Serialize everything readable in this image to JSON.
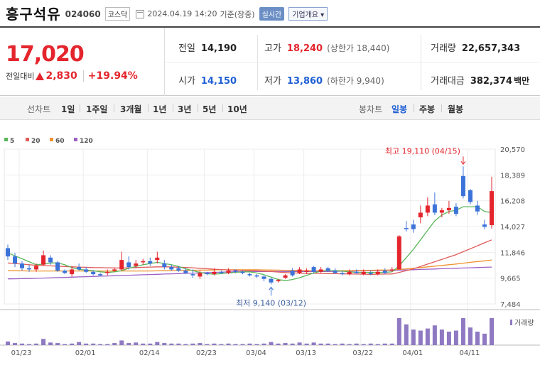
{
  "header": {
    "name": "흥구석유",
    "code": "024060",
    "market": "코스닥",
    "datetime": "2024.04.19 14:20",
    "basis": "기준(장중)",
    "realtime_label": "실시간",
    "company_button": "기업개요 ▾"
  },
  "price": {
    "current": "17,020",
    "change_label": "전일대비",
    "change": "2,830",
    "change_pct": "+19.94%",
    "prev_close_label": "전일",
    "prev_close": "14,190",
    "high_label": "고가",
    "high": "18,240",
    "upper_limit": "(상한가 18,440)",
    "volume_label": "거래량",
    "volume": "22,657,343",
    "open_label": "시가",
    "open": "14,150",
    "low_label": "저가",
    "low": "13,860",
    "lower_limit": "(하한가 9,940)",
    "amount_label": "거래대금",
    "amount": "382,374",
    "amount_unit": "백만"
  },
  "periods": {
    "line_label": "선차트",
    "items": [
      "1일",
      "1주일",
      "3개월",
      "1년",
      "3년",
      "5년",
      "10년"
    ],
    "candle_label": "봉차트",
    "candle_items": [
      "일봉",
      "주봉",
      "월봉"
    ],
    "candle_active": "일봉"
  },
  "colors": {
    "up": "#e4252d",
    "down": "#3b73d9",
    "ma5": "#5ab65a",
    "ma20": "#e05a5a",
    "ma60": "#f0922e",
    "ma120": "#9b62c7",
    "volume": "#8e79c2"
  },
  "chart_data": {
    "type": "candlestick",
    "legend": [
      "5",
      "20",
      "60",
      "120"
    ],
    "x_tick_labels": [
      "01/23",
      "02/01",
      "02/14",
      "02/23",
      "03/04",
      "03/13",
      "03/22",
      "04/01",
      "04/11"
    ],
    "y_tick_labels": [
      "20,570",
      "18,389",
      "16,208",
      "14,027",
      "11,846",
      "9,665",
      "7,484"
    ],
    "ylim": [
      7484,
      20570
    ],
    "high_annotation": "최고 19,110 (04/15)",
    "low_annotation": "최저 9,140 (03/12)",
    "volume_label": "거래량",
    "candles": [
      {
        "o": 12200,
        "c": 11500,
        "h": 12500,
        "l": 11200
      },
      {
        "o": 11500,
        "c": 10900,
        "h": 11800,
        "l": 10600
      },
      {
        "o": 10900,
        "c": 10500,
        "h": 11100,
        "l": 10300
      },
      {
        "o": 10500,
        "c": 10400,
        "h": 10800,
        "l": 10200
      },
      {
        "o": 10400,
        "c": 10700,
        "h": 10900,
        "l": 10200
      },
      {
        "o": 10800,
        "c": 11600,
        "h": 12000,
        "l": 10700
      },
      {
        "o": 11400,
        "c": 11000,
        "h": 11600,
        "l": 10800
      },
      {
        "o": 11000,
        "c": 10300,
        "h": 11100,
        "l": 10200
      },
      {
        "o": 10300,
        "c": 10100,
        "h": 10400,
        "l": 10000
      },
      {
        "o": 10000,
        "c": 10400,
        "h": 10700,
        "l": 9800
      },
      {
        "o": 10600,
        "c": 10400,
        "h": 10900,
        "l": 10300
      },
      {
        "o": 10400,
        "c": 10200,
        "h": 10600,
        "l": 10100
      },
      {
        "o": 10200,
        "c": 10000,
        "h": 10300,
        "l": 9900
      },
      {
        "o": 10000,
        "c": 9900,
        "h": 10100,
        "l": 9800
      },
      {
        "o": 10100,
        "c": 10200,
        "h": 10400,
        "l": 9900
      },
      {
        "o": 10300,
        "c": 10400,
        "h": 10500,
        "l": 10200
      },
      {
        "o": 10400,
        "c": 11200,
        "h": 11900,
        "l": 10300
      },
      {
        "o": 11000,
        "c": 10600,
        "h": 11500,
        "l": 10400
      },
      {
        "o": 10700,
        "c": 10900,
        "h": 11200,
        "l": 10500
      },
      {
        "o": 11000,
        "c": 11100,
        "h": 11300,
        "l": 10800
      },
      {
        "o": 11100,
        "c": 10900,
        "h": 11400,
        "l": 10700
      },
      {
        "o": 11200,
        "c": 11400,
        "h": 11900,
        "l": 10900
      },
      {
        "o": 10900,
        "c": 10600,
        "h": 11200,
        "l": 10400
      },
      {
        "o": 10600,
        "c": 10400,
        "h": 10800,
        "l": 10300
      },
      {
        "o": 10500,
        "c": 10300,
        "h": 10700,
        "l": 10200
      },
      {
        "o": 10300,
        "c": 10100,
        "h": 10500,
        "l": 10000
      },
      {
        "o": 10000,
        "c": 9900,
        "h": 10400,
        "l": 9700
      },
      {
        "o": 9800,
        "c": 10100,
        "h": 10300,
        "l": 9600
      },
      {
        "o": 10100,
        "c": 10000,
        "h": 10200,
        "l": 9900
      },
      {
        "o": 10000,
        "c": 10200,
        "h": 10500,
        "l": 9900
      },
      {
        "o": 10200,
        "c": 10100,
        "h": 10300,
        "l": 10000
      },
      {
        "o": 10100,
        "c": 10300,
        "h": 10500,
        "l": 10000
      },
      {
        "o": 10300,
        "c": 10200,
        "h": 10400,
        "l": 10100
      },
      {
        "o": 10200,
        "c": 10100,
        "h": 10300,
        "l": 10000
      },
      {
        "o": 10000,
        "c": 9900,
        "h": 10100,
        "l": 9800
      },
      {
        "o": 9900,
        "c": 9800,
        "h": 10000,
        "l": 9700
      },
      {
        "o": 9800,
        "c": 9600,
        "h": 9900,
        "l": 9400
      },
      {
        "o": 9600,
        "c": 9300,
        "h": 9700,
        "l": 9140
      },
      {
        "o": 9400,
        "c": 9500,
        "h": 9600,
        "l": 9300
      },
      {
        "o": 9700,
        "c": 9900,
        "h": 10000,
        "l": 9600
      },
      {
        "o": 10300,
        "c": 9900,
        "h": 10500,
        "l": 9800
      },
      {
        "o": 10100,
        "c": 10400,
        "h": 10600,
        "l": 10000
      },
      {
        "o": 10200,
        "c": 10300,
        "h": 10500,
        "l": 10000
      },
      {
        "o": 10600,
        "c": 10200,
        "h": 10700,
        "l": 10100
      },
      {
        "o": 10200,
        "c": 10400,
        "h": 10600,
        "l": 10100
      },
      {
        "o": 10500,
        "c": 10300,
        "h": 10600,
        "l": 10200
      },
      {
        "o": 10300,
        "c": 10100,
        "h": 10500,
        "l": 10000
      },
      {
        "o": 10100,
        "c": 10000,
        "h": 10300,
        "l": 9900
      },
      {
        "o": 10000,
        "c": 10200,
        "h": 10400,
        "l": 9900
      },
      {
        "o": 10200,
        "c": 10100,
        "h": 10400,
        "l": 10000
      },
      {
        "o": 10000,
        "c": 10200,
        "h": 10400,
        "l": 9900
      },
      {
        "o": 10100,
        "c": 10000,
        "h": 10300,
        "l": 9900
      },
      {
        "o": 10000,
        "c": 10200,
        "h": 10400,
        "l": 9900
      },
      {
        "o": 10300,
        "c": 10100,
        "h": 10500,
        "l": 10000
      },
      {
        "o": 10300,
        "c": 10400,
        "h": 10600,
        "l": 10200
      },
      {
        "o": 10400,
        "c": 13200,
        "h": 13300,
        "l": 10400
      },
      {
        "o": 13900,
        "c": 13800,
        "h": 14500,
        "l": 13600
      },
      {
        "o": 14200,
        "c": 13800,
        "h": 14600,
        "l": 13500
      },
      {
        "o": 14800,
        "c": 15200,
        "h": 15800,
        "l": 14300
      },
      {
        "o": 15200,
        "c": 15800,
        "h": 16500,
        "l": 14900
      },
      {
        "o": 15900,
        "c": 15200,
        "h": 16900,
        "l": 15000
      },
      {
        "o": 15200,
        "c": 15400,
        "h": 15600,
        "l": 14800
      },
      {
        "o": 15400,
        "c": 15600,
        "h": 16200,
        "l": 15100
      },
      {
        "o": 15700,
        "c": 15100,
        "h": 16000,
        "l": 14900
      },
      {
        "o": 18300,
        "c": 16600,
        "h": 19110,
        "l": 16400
      },
      {
        "o": 17100,
        "c": 16100,
        "h": 17200,
        "l": 15900
      },
      {
        "o": 15800,
        "c": 15300,
        "h": 16200,
        "l": 15000
      },
      {
        "o": 14200,
        "c": 14000,
        "h": 14600,
        "l": 13800
      },
      {
        "o": 14150,
        "c": 17020,
        "h": 18240,
        "l": 13860
      }
    ],
    "ma5": [
      11800,
      11550,
      11300,
      11050,
      10800,
      10850,
      10950,
      10950,
      10800,
      10550,
      10400,
      10350,
      10300,
      10200,
      10150,
      10200,
      10300,
      10500,
      10650,
      10800,
      10900,
      11000,
      10900,
      10800,
      10650,
      10450,
      10300,
      10150,
      10050,
      10000,
      10050,
      10100,
      10150,
      10200,
      10200,
      10100,
      9950,
      9750,
      9550,
      9450,
      9550,
      9700,
      9900,
      10100,
      10250,
      10300,
      10300,
      10250,
      10200,
      10150,
      10150,
      10150,
      10150,
      10150,
      10200,
      10700,
      11400,
      12100,
      12900,
      13700,
      14500,
      15000,
      15300,
      15400,
      15700,
      15700,
      15700,
      15300,
      15200
    ],
    "ma20": [
      10950,
      10900,
      10850,
      10800,
      10750,
      10730,
      10700,
      10680,
      10650,
      10620,
      10600,
      10580,
      10560,
      10550,
      10540,
      10530,
      10520,
      10540,
      10560,
      10580,
      10600,
      10620,
      10620,
      10610,
      10590,
      10570,
      10540,
      10500,
      10460,
      10420,
      10390,
      10360,
      10340,
      10320,
      10300,
      10280,
      10250,
      10220,
      10180,
      10140,
      10110,
      10090,
      10080,
      10070,
      10060,
      10050,
      10040,
      10030,
      10020,
      10010,
      10000,
      9990,
      10000,
      10010,
      10020,
      10150,
      10300,
      10450,
      10650,
      10850,
      11050,
      11250,
      11450,
      11650,
      11900,
      12150,
      12400,
      12650,
      12900
    ],
    "ma60": [
      10300,
      10290,
      10280,
      10270,
      10270,
      10270,
      10270,
      10270,
      10270,
      10270,
      10270,
      10270,
      10270,
      10270,
      10270,
      10270,
      10270,
      10270,
      10270,
      10270,
      10270,
      10280,
      10290,
      10300,
      10310,
      10320,
      10330,
      10340,
      10350,
      10360,
      10370,
      10370,
      10370,
      10370,
      10370,
      10370,
      10360,
      10350,
      10340,
      10330,
      10320,
      10310,
      10300,
      10300,
      10300,
      10300,
      10300,
      10300,
      10300,
      10310,
      10320,
      10330,
      10340,
      10350,
      10360,
      10400,
      10450,
      10500,
      10560,
      10620,
      10680,
      10740,
      10800,
      10860,
      10930,
      11000,
      11070,
      11130,
      11200
    ],
    "ma120": [
      9600,
      9610,
      9620,
      9630,
      9650,
      9670,
      9690,
      9710,
      9730,
      9750,
      9770,
      9790,
      9810,
      9830,
      9850,
      9870,
      9890,
      9910,
      9930,
      9950,
      9970,
      9990,
      10010,
      10030,
      10050,
      10070,
      10090,
      10110,
      10130,
      10150,
      10170,
      10190,
      10200,
      10210,
      10220,
      10230,
      10230,
      10230,
      10230,
      10230,
      10230,
      10230,
      10230,
      10230,
      10230,
      10230,
      10240,
      10250,
      10260,
      10270,
      10280,
      10290,
      10300,
      10310,
      10320,
      10340,
      10360,
      10380,
      10400,
      10420,
      10440,
      10460,
      10480,
      10500,
      10520,
      10540,
      10560,
      10580,
      10600
    ],
    "volume": [
      7,
      4,
      3,
      2,
      3,
      12,
      5,
      4,
      2,
      3,
      6,
      3,
      3,
      2,
      2,
      4,
      9,
      4,
      5,
      3,
      3,
      6,
      4,
      3,
      3,
      2,
      3,
      4,
      2,
      3,
      2,
      3,
      2,
      2,
      3,
      2,
      3,
      6,
      3,
      4,
      3,
      5,
      3,
      5,
      3,
      3,
      2,
      3,
      2,
      3,
      2,
      3,
      2,
      3,
      3,
      52,
      40,
      30,
      28,
      32,
      38,
      30,
      26,
      28,
      52,
      34,
      26,
      22,
      52
    ]
  }
}
